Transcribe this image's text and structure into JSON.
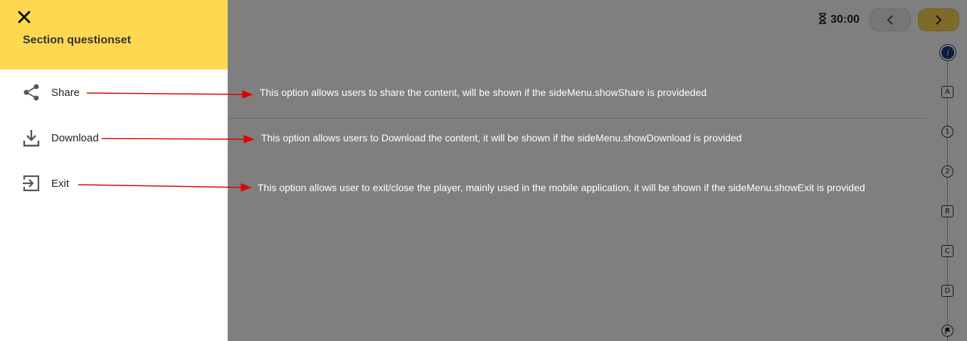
{
  "timer": {
    "value": "30:00"
  },
  "progress": {
    "nodes": [
      {
        "label": "i",
        "kind": "info"
      },
      {
        "label": "A",
        "kind": "square"
      },
      {
        "label": "1",
        "kind": "circle"
      },
      {
        "label": "2",
        "kind": "circle"
      },
      {
        "label": "B",
        "kind": "square"
      },
      {
        "label": "C",
        "kind": "square"
      },
      {
        "label": "D",
        "kind": "square"
      },
      {
        "label": "",
        "kind": "flag"
      }
    ]
  },
  "side_menu": {
    "title": "Section questionset",
    "items": [
      {
        "label": "Share",
        "icon": "share-icon"
      },
      {
        "label": "Download",
        "icon": "download-icon"
      },
      {
        "label": "Exit",
        "icon": "exit-icon"
      }
    ]
  },
  "annotations": [
    "This option allows users to share the content, will be shown if the sideMenu.showShare is provideded",
    "This option allows users to Download the content, it will be shown if the sideMenu.showDownload is provided",
    "This option allows user to exit/close the player, mainly used in the mobile application, it will be shown if the sideMenu.showExit is provided"
  ],
  "colors": {
    "header_yellow": "#FFD852",
    "next_button": "#FFD555",
    "annotation_arrow": "#e00000",
    "overlay": "rgba(0,0,0,0.5)"
  }
}
